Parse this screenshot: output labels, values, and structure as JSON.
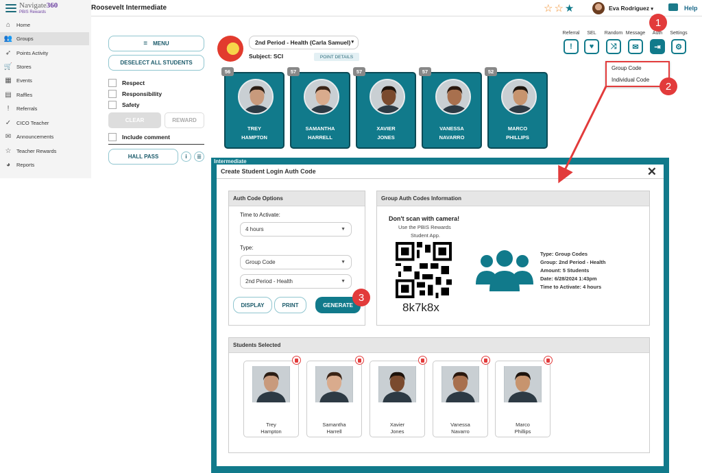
{
  "brand": {
    "name_prefix": "Navigate",
    "name_suffix": "360",
    "sub": "PBIS Rewards"
  },
  "sidebar": {
    "items": [
      {
        "label": "Home",
        "icon": "home-icon"
      },
      {
        "label": "Groups",
        "icon": "groups-icon"
      },
      {
        "label": "Points Activity",
        "icon": "rocket-icon"
      },
      {
        "label": "Stores",
        "icon": "cart-icon"
      },
      {
        "label": "Events",
        "icon": "calendar-icon"
      },
      {
        "label": "Raffles",
        "icon": "ticket-icon"
      },
      {
        "label": "Referrals",
        "icon": "alert-icon"
      },
      {
        "label": "CICO Teacher",
        "icon": "check-circle-icon"
      },
      {
        "label": "Announcements",
        "icon": "mail-icon"
      },
      {
        "label": "Teacher Rewards",
        "icon": "star-icon"
      },
      {
        "label": "Reports",
        "icon": "pie-chart-icon"
      }
    ]
  },
  "topbar": {
    "school": "Roosevelt Intermediate",
    "user": "Eva Rodriguez",
    "help": "Help",
    "star_colors": [
      "#f08a24",
      "#f08a24",
      "#117a8b"
    ]
  },
  "left_panel": {
    "menu": "MENU",
    "deselect": "DESELECT ALL STUDENTS",
    "checks": [
      "Respect",
      "Responsibility",
      "Safety"
    ],
    "clear": "CLEAR",
    "reward": "REWARD",
    "include_comment": "Include comment",
    "hall_pass": "HALL PASS"
  },
  "class": {
    "period": "2nd Period - Health (Carla Samuel)",
    "subject": "Subject: SCI",
    "point_details": "POINT DETAILS"
  },
  "tools": {
    "labels": [
      "Referral",
      "SEL",
      "Random",
      "Message",
      "Auth",
      "Settings"
    ]
  },
  "auth_menu": {
    "items": [
      "Group Code",
      "Individual Code"
    ]
  },
  "students": [
    {
      "name": "TREY\nHAMPTON",
      "points": "56",
      "short": "Trey\nHampton",
      "skin": "#c89a7c",
      "hair": "#2b1d14"
    },
    {
      "name": "SAMANTHA\nHARRELL",
      "points": "57",
      "short": "Samantha\nHarrell",
      "skin": "#d9ab8d",
      "hair": "#3b2416"
    },
    {
      "name": "XAVIER\nJONES",
      "points": "57",
      "short": "Xavier\nJones",
      "skin": "#7a4a2e",
      "hair": "#1d120b"
    },
    {
      "name": "VANESSA\nNAVARRO",
      "points": "57",
      "short": "Vanessa\nNavarro",
      "skin": "#a8704e",
      "hair": "#2a170d"
    },
    {
      "name": "MARCO\nPHILLIPS",
      "points": "52",
      "short": "Marco\nPhillips",
      "skin": "#c7946e",
      "hair": "#1e140d"
    }
  ],
  "modal": {
    "title": "Create Student Login Auth Code",
    "behind_text": "Intermediate",
    "options_head": "Auth Code Options",
    "time_label": "Time to Activate:",
    "time_value": "4 hours",
    "type_label": "Type:",
    "type_value": "Group Code",
    "group_value": "2nd Period - Health",
    "display": "DISPLAY",
    "print": "PRINT",
    "generate": "GENERATE",
    "info_head": "Group Auth Codes Information",
    "dont_scan": "Don't scan with camera!",
    "use_app_1": "Use the PBIS Rewards",
    "use_app_2": "Student App.",
    "code": "8k7k8x",
    "info_lines": [
      "Type: Group Codes",
      "Group: 2nd Period - Health",
      "Amount: 5 Students",
      "Date: 6/28/2024 1:43pm",
      "Time to Activate: 4 hours"
    ],
    "selected_head": "Students Selected"
  },
  "callouts": [
    "1",
    "2",
    "3"
  ],
  "colors": {
    "teal": "#117a8b",
    "red": "#e23b3b",
    "purple": "#6b3fa0"
  }
}
